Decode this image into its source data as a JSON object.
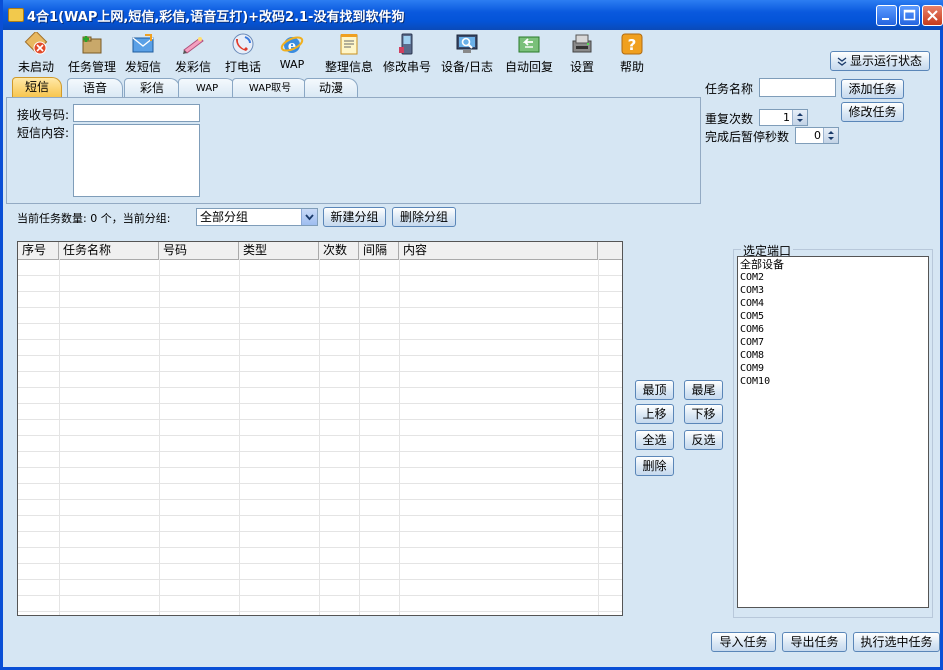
{
  "window": {
    "title": "4合1(WAP上网,短信,彩信,语音互打)+改码2.1-没有找到软件狗"
  },
  "toolbar": [
    {
      "label": "未启动",
      "icon": "not-started-icon"
    },
    {
      "label": "任务管理",
      "icon": "task-manage-icon"
    },
    {
      "label": "发短信",
      "icon": "send-sms-icon"
    },
    {
      "label": "发彩信",
      "icon": "send-mms-icon"
    },
    {
      "label": "打电话",
      "icon": "phone-call-icon"
    },
    {
      "label": "WAP",
      "icon": "ie-browser-icon"
    },
    {
      "label": "整理信息",
      "icon": "notepad-icon"
    },
    {
      "label": "修改串号",
      "icon": "mobile-device-icon"
    },
    {
      "label": "设备/日志",
      "icon": "device-log-icon"
    },
    {
      "label": "自动回复",
      "icon": "auto-reply-icon"
    },
    {
      "label": "设置",
      "icon": "settings-icon"
    },
    {
      "label": "帮助",
      "icon": "help-icon"
    }
  ],
  "show_status_button": "显示运行状态",
  "tabs": [
    "短信",
    "语音",
    "彩信",
    "WAP",
    "WAP取号",
    "动漫"
  ],
  "sms_form": {
    "receiver_label": "接收号码:",
    "content_label": "短信内容:",
    "receiver_value": "",
    "content_value": ""
  },
  "task_form": {
    "task_name_label": "任务名称",
    "task_name_value": "",
    "repeat_label": "重复次数",
    "repeat_value": "1",
    "pause_label": "完成后暂停秒数",
    "pause_value": "0",
    "add_button": "添加任务",
    "edit_button": "修改任务"
  },
  "group_bar": {
    "count_text": "当前任务数量: 0 个，当前分组:",
    "group_selected": "全部分组",
    "new_group_button": "新建分组",
    "delete_group_button": "删除分组"
  },
  "grid": {
    "columns": [
      "序号",
      "任务名称",
      "号码",
      "类型",
      "次数",
      "间隔",
      "内容"
    ]
  },
  "order_buttons": {
    "top": "最顶",
    "bottom": "最尾",
    "up": "上移",
    "down": "下移",
    "select_all": "全选",
    "invert": "反选",
    "delete": "删除"
  },
  "ports": {
    "legend": "选定端口",
    "items": [
      "全部设备",
      "COM2",
      "COM3",
      "COM4",
      "COM5",
      "COM6",
      "COM7",
      "COM8",
      "COM9",
      "COM10"
    ]
  },
  "bottom_buttons": {
    "import": "导入任务",
    "export": "导出任务",
    "execute": "执行选中任务"
  }
}
